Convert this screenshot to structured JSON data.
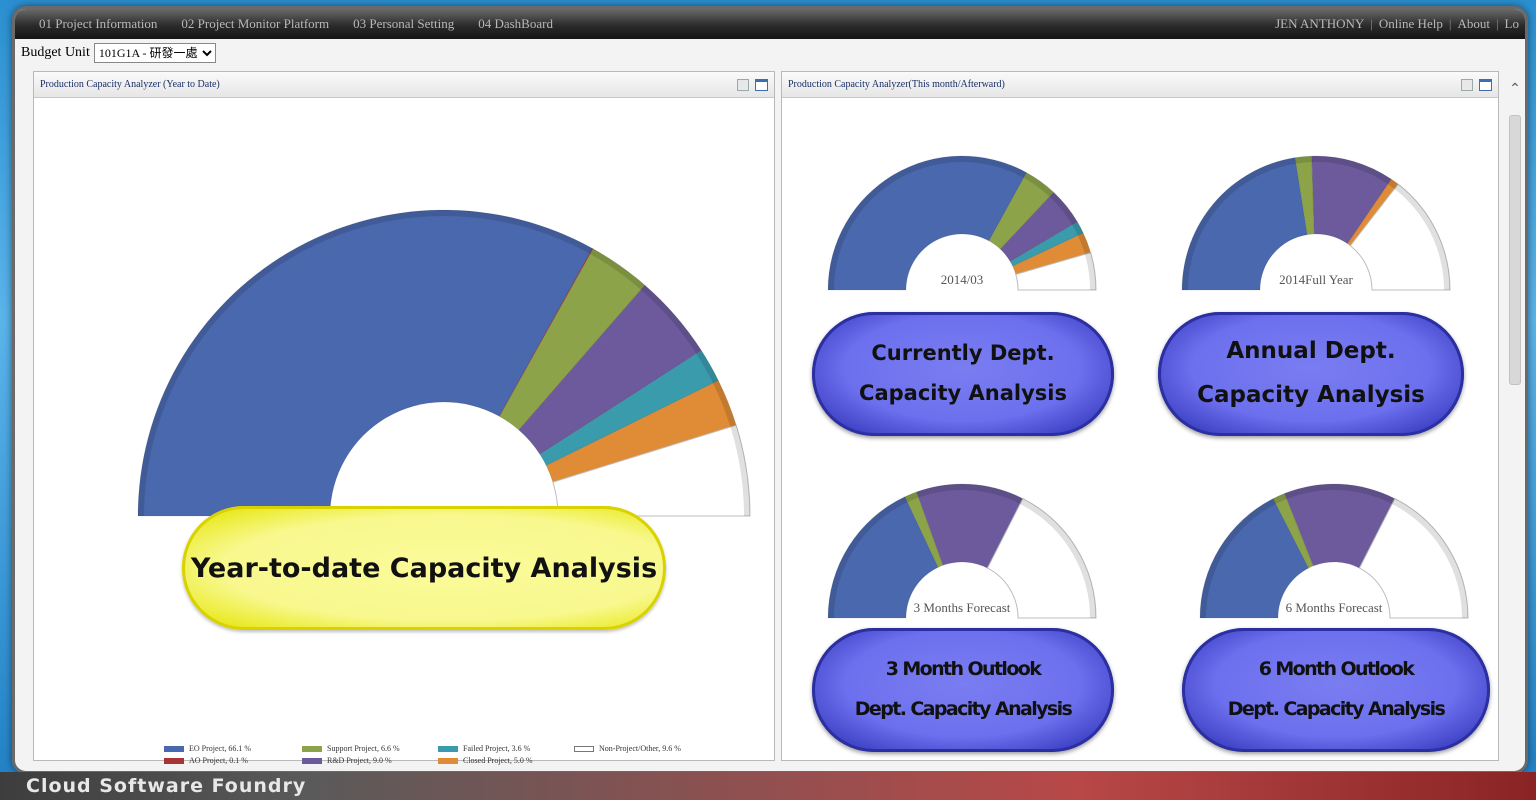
{
  "menu": {
    "items": [
      "01 Project Information",
      "02 Project Monitor Platform",
      "03 Personal Setting",
      "04 DashBoard"
    ],
    "user": "JEN ANTHONY",
    "help": "Online Help",
    "about": "About",
    "logout": "Lo"
  },
  "toolbar": {
    "budget_label": "Budget Unit",
    "budget_value": "101G1A - 研發一處"
  },
  "left_panel": {
    "title": "Production Capacity Analyzer (Year to Date)",
    "callout": "Year-to-date Capacity Analysis",
    "legend": [
      {
        "label": "EO Project, 66.1 %",
        "color": "#4a68ad"
      },
      {
        "label": "Support Project, 6.6 %",
        "color": "#8da34a"
      },
      {
        "label": "Failed Project, 3.6 %",
        "color": "#3a9bad"
      },
      {
        "label": "Non-Project/Other, 9.6 %",
        "color": "#ffffff"
      },
      {
        "label": "AO Project, 0.1 %",
        "color": "#a83535"
      },
      {
        "label": "R&D Project, 9.0 %",
        "color": "#6d5a9c"
      },
      {
        "label": "Closed Project, 5.0 %",
        "color": "#e08b35"
      }
    ]
  },
  "right_panel": {
    "title": "Production Capacity Analyzer(This month/Afterward)",
    "charts": [
      {
        "center_label": "2014/03",
        "callout_line1": "Currently Dept.",
        "callout_line2": "Capacity Analysis"
      },
      {
        "center_label": "2014Full Year",
        "callout_line1": "Annual Dept.",
        "callout_line2": "Capacity Analysis"
      },
      {
        "center_label": "3 Months Forecast",
        "callout_line1": "3 Month Outlook",
        "callout_line2": "Dept. Capacity Analysis"
      },
      {
        "center_label": "6 Months Forecast",
        "callout_line1": "6 Month Outlook",
        "callout_line2": "Dept. Capacity Analysis"
      }
    ]
  },
  "footer": {
    "brand": "Cloud Software Foundry"
  },
  "colors": {
    "eo": "#4a68ad",
    "support": "#8da34a",
    "rd": "#6d5a9c",
    "failed": "#3a9bad",
    "closed": "#e08b35",
    "ao": "#a83535",
    "other": "#ffffff"
  },
  "chart_data": [
    {
      "type": "pie",
      "title": "Production Capacity Analyzer (Year to Date)",
      "shape": "half-donut",
      "slices": [
        {
          "name": "EO Project",
          "value": 66.1
        },
        {
          "name": "AO Project",
          "value": 0.1
        },
        {
          "name": "Support Project",
          "value": 6.6
        },
        {
          "name": "R&D Project",
          "value": 9.0
        },
        {
          "name": "Failed Project",
          "value": 3.6
        },
        {
          "name": "Closed Project",
          "value": 5.0
        },
        {
          "name": "Non-Project/Other",
          "value": 9.6
        }
      ]
    },
    {
      "type": "pie",
      "shape": "half-donut",
      "center_label": "2014/03",
      "slices": [
        {
          "name": "EO Project",
          "value": 66
        },
        {
          "name": "Support Project",
          "value": 8
        },
        {
          "name": "R&D Project",
          "value": 9
        },
        {
          "name": "Failed Project",
          "value": 3
        },
        {
          "name": "Closed Project",
          "value": 5
        },
        {
          "name": "Non-Project/Other",
          "value": 9
        }
      ]
    },
    {
      "type": "pie",
      "shape": "half-donut",
      "center_label": "2014Full Year",
      "slices": [
        {
          "name": "EO Project",
          "value": 45
        },
        {
          "name": "Support Project",
          "value": 4
        },
        {
          "name": "R&D Project",
          "value": 20
        },
        {
          "name": "Closed Project",
          "value": 2
        },
        {
          "name": "Non-Project/Other",
          "value": 29
        }
      ]
    },
    {
      "type": "pie",
      "shape": "half-donut",
      "center_label": "3 Months Forecast",
      "slices": [
        {
          "name": "EO Project",
          "value": 36
        },
        {
          "name": "Support Project",
          "value": 3
        },
        {
          "name": "R&D Project",
          "value": 26
        },
        {
          "name": "Non-Project/Other",
          "value": 35
        }
      ]
    },
    {
      "type": "pie",
      "shape": "half-donut",
      "center_label": "6 Months Forecast",
      "slices": [
        {
          "name": "EO Project",
          "value": 35
        },
        {
          "name": "Support Project",
          "value": 3
        },
        {
          "name": "R&D Project",
          "value": 27
        },
        {
          "name": "Non-Project/Other",
          "value": 35
        }
      ]
    }
  ]
}
